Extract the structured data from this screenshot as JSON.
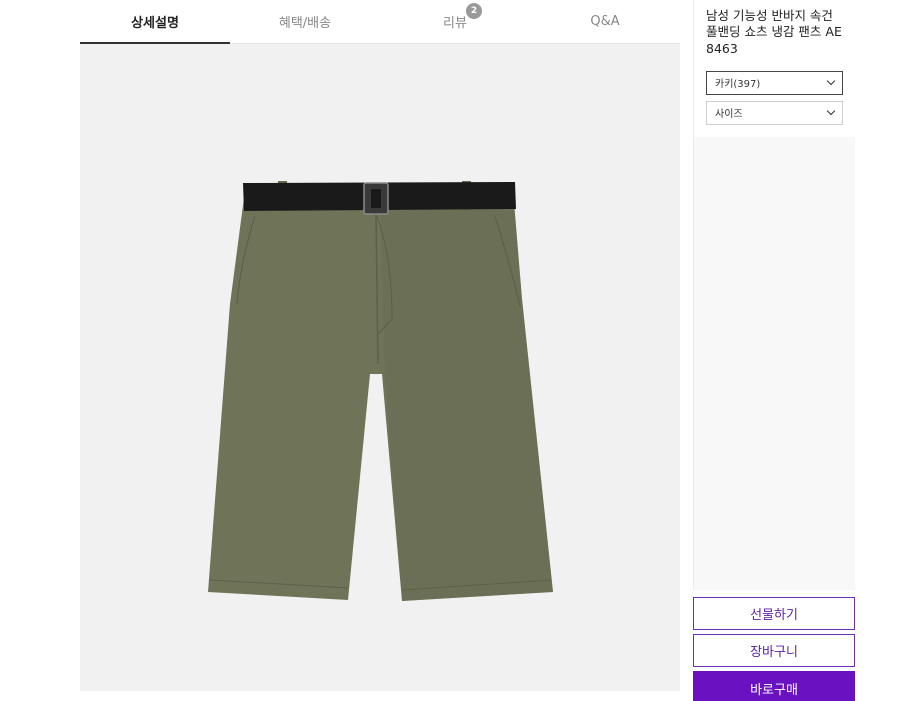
{
  "tabs": [
    {
      "label": "상세설명",
      "active": true
    },
    {
      "label": "혜택/배송",
      "active": false
    },
    {
      "label": "리뷰",
      "active": false,
      "badge": "2"
    },
    {
      "label": "Q&A",
      "active": false
    }
  ],
  "product": {
    "title": "남성 기능성 반바지 속건 풀밴딩 쇼츠 냉감 팬츠 AE8463",
    "image_alt": "khaki shorts with black belt",
    "color_select": "카키(397)",
    "size_select": "사이즈"
  },
  "actions": {
    "gift": "선물하기",
    "cart": "장바구니",
    "buy": "바로구매"
  },
  "colors": {
    "accent": "#6a12c2",
    "shorts": "#6f7358",
    "belt": "#1a1a1a"
  }
}
